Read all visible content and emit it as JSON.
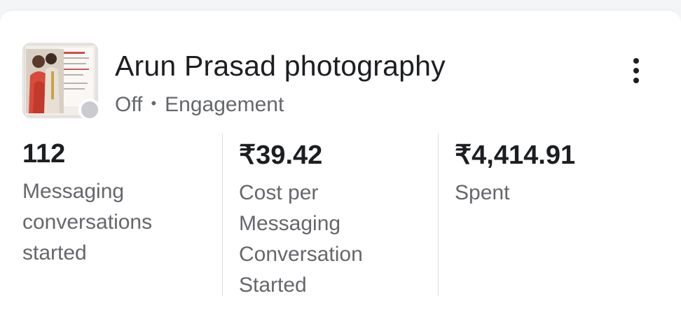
{
  "campaign": {
    "name": "Arun Prasad photography",
    "status": "Off",
    "separator": "•",
    "objective": "Engagement",
    "status_color": "#c9cbcf",
    "thumbnail": "wedding-photo-thumbnail"
  },
  "menu_icon": "more-vertical-icon",
  "metrics": [
    {
      "value": "112",
      "label_lines": [
        "Messaging",
        "conversations",
        "started"
      ]
    },
    {
      "value": "₹39.42",
      "label_lines": [
        "Cost per",
        "Messaging",
        "Conversation",
        "Started"
      ]
    },
    {
      "value": "₹4,414.91",
      "label_lines": [
        "Spent"
      ]
    }
  ]
}
